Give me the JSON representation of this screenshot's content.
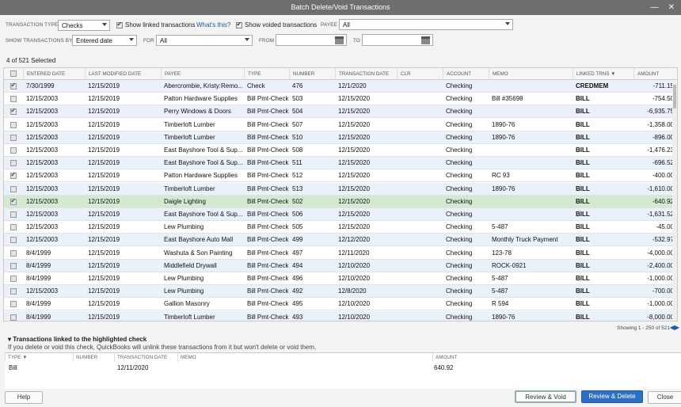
{
  "window": {
    "title": "Batch Delete/Void Transactions",
    "minimize": "—",
    "close": "✕"
  },
  "filters": {
    "transaction_type_label": "TRANSACTION TYPE",
    "transaction_type_value": "Checks",
    "show_linked_label": "Show linked transactions",
    "show_linked_checked": true,
    "whats_this": "What's this?",
    "show_voided_label": "Show voided transactions",
    "show_voided_checked": true,
    "payee_label": "PAYEE",
    "payee_value": "All",
    "show_by_label": "SHOW TRANSACTIONS BY",
    "show_by_value": "Entered date",
    "for_label": "FOR",
    "for_value": "All",
    "from_label": "FROM",
    "from_value": "",
    "to_label": "TO",
    "to_value": ""
  },
  "selected_count": "4 of 521 Selected",
  "grid": {
    "headers": {
      "entered": "ENTERED DATE",
      "modified": "LAST MODIFIED DATE",
      "payee": "PAYEE",
      "type": "TYPE",
      "number": "NUMBER",
      "txn_date": "TRANSACTION DATE",
      "clr": "CLR",
      "account": "ACCOUNT",
      "memo": "MEMO",
      "linked": "LINKED TRNS ▼",
      "amount": "AMOUNT"
    },
    "rows": [
      {
        "checked": true,
        "entered": "7/30/1999",
        "modified": "12/15/2019",
        "payee": "Abercrombie, Kristy:Remo...",
        "type": "Check",
        "number": "476",
        "txn_date": "12/1/2020",
        "clr": "",
        "account": "Checking",
        "memo": "",
        "linked": "CREDMEM",
        "amount": "-711.15"
      },
      {
        "checked": false,
        "entered": "12/15/2003",
        "modified": "12/15/2019",
        "payee": "Patton Hardware Supplies",
        "type": "Bill Pmt-Check",
        "number": "503",
        "txn_date": "12/15/2020",
        "clr": "",
        "account": "Checking",
        "memo": "Bill #35698",
        "linked": "BILL",
        "amount": "-754.50"
      },
      {
        "checked": true,
        "entered": "12/15/2003",
        "modified": "12/15/2019",
        "payee": "Perry Windows & Doors",
        "type": "Bill Pmt-Check",
        "number": "504",
        "txn_date": "12/15/2020",
        "clr": "",
        "account": "Checking",
        "memo": "",
        "linked": "BILL",
        "amount": "-6,935.75"
      },
      {
        "checked": false,
        "entered": "12/15/2003",
        "modified": "12/15/2019",
        "payee": "Timberloft Lumber",
        "type": "Bill Pmt-Check",
        "number": "507",
        "txn_date": "12/15/2020",
        "clr": "",
        "account": "Checking",
        "memo": "1890-76",
        "linked": "BILL",
        "amount": "-1,358.00"
      },
      {
        "checked": false,
        "entered": "12/15/2003",
        "modified": "12/15/2019",
        "payee": "Timberloft Lumber",
        "type": "Bill Pmt-Check",
        "number": "510",
        "txn_date": "12/15/2020",
        "clr": "",
        "account": "Checking",
        "memo": "1890-76",
        "linked": "BILL",
        "amount": "-896.00"
      },
      {
        "checked": false,
        "entered": "12/15/2003",
        "modified": "12/15/2019",
        "payee": "East Bayshore Tool & Sup...",
        "type": "Bill Pmt-Check",
        "number": "508",
        "txn_date": "12/15/2020",
        "clr": "",
        "account": "Checking",
        "memo": "",
        "linked": "BILL",
        "amount": "-1,476.23"
      },
      {
        "checked": false,
        "entered": "12/15/2003",
        "modified": "12/15/2019",
        "payee": "East Bayshore Tool & Sup...",
        "type": "Bill Pmt-Check",
        "number": "511",
        "txn_date": "12/15/2020",
        "clr": "",
        "account": "Checking",
        "memo": "",
        "linked": "BILL",
        "amount": "-696.52"
      },
      {
        "checked": true,
        "entered": "12/15/2003",
        "modified": "12/15/2019",
        "payee": "Patton Hardware Supplies",
        "type": "Bill Pmt-Check",
        "number": "512",
        "txn_date": "12/15/2020",
        "clr": "",
        "account": "Checking",
        "memo": "RC 93",
        "linked": "BILL",
        "amount": "-400.00"
      },
      {
        "checked": false,
        "entered": "12/15/2003",
        "modified": "12/15/2019",
        "payee": "Timberloft Lumber",
        "type": "Bill Pmt-Check",
        "number": "513",
        "txn_date": "12/15/2020",
        "clr": "",
        "account": "Checking",
        "memo": "1890-76",
        "linked": "BILL",
        "amount": "-1,610.00"
      },
      {
        "checked": true,
        "entered": "12/15/2003",
        "modified": "12/15/2019",
        "payee": "Daigle Lighting",
        "type": "Bill Pmt-Check",
        "number": "502",
        "txn_date": "12/15/2020",
        "clr": "",
        "account": "Checking",
        "memo": "",
        "linked": "BILL",
        "amount": "-640.92",
        "highlight": true
      },
      {
        "checked": false,
        "entered": "12/15/2003",
        "modified": "12/15/2019",
        "payee": "East Bayshore Tool & Sup...",
        "type": "Bill Pmt-Check",
        "number": "506",
        "txn_date": "12/15/2020",
        "clr": "",
        "account": "Checking",
        "memo": "",
        "linked": "BILL",
        "amount": "-1,631.52"
      },
      {
        "checked": false,
        "entered": "12/15/2003",
        "modified": "12/15/2019",
        "payee": "Lew Plumbing",
        "type": "Bill Pmt-Check",
        "number": "505",
        "txn_date": "12/15/2020",
        "clr": "",
        "account": "Checking",
        "memo": "5-487",
        "linked": "BILL",
        "amount": "-45.00"
      },
      {
        "checked": false,
        "entered": "12/15/2003",
        "modified": "12/15/2019",
        "payee": "East Bayshore Auto Mall",
        "type": "Bill Pmt-Check",
        "number": "499",
        "txn_date": "12/12/2020",
        "clr": "",
        "account": "Checking",
        "memo": "Monthly Truck Payment",
        "linked": "BILL",
        "amount": "-532.97"
      },
      {
        "checked": false,
        "entered": "8/4/1999",
        "modified": "12/15/2019",
        "payee": "Washuta & Son Painting",
        "type": "Bill Pmt-Check",
        "number": "497",
        "txn_date": "12/11/2020",
        "clr": "",
        "account": "Checking",
        "memo": "123-78",
        "linked": "BILL",
        "amount": "-4,000.00"
      },
      {
        "checked": false,
        "entered": "8/4/1999",
        "modified": "12/15/2019",
        "payee": "Middlefield Drywall",
        "type": "Bill Pmt-Check",
        "number": "494",
        "txn_date": "12/10/2020",
        "clr": "",
        "account": "Checking",
        "memo": "ROCK-0921",
        "linked": "BILL",
        "amount": "-2,400.00"
      },
      {
        "checked": false,
        "entered": "8/4/1999",
        "modified": "12/15/2019",
        "payee": "Lew Plumbing",
        "type": "Bill Pmt-Check",
        "number": "496",
        "txn_date": "12/10/2020",
        "clr": "",
        "account": "Checking",
        "memo": "5-487",
        "linked": "BILL",
        "amount": "-1,000.00"
      },
      {
        "checked": false,
        "entered": "12/15/2003",
        "modified": "12/15/2019",
        "payee": "Lew Plumbing",
        "type": "Bill Pmt-Check",
        "number": "492",
        "txn_date": "12/8/2020",
        "clr": "",
        "account": "Checking",
        "memo": "5-487",
        "linked": "BILL",
        "amount": "-700.00"
      },
      {
        "checked": false,
        "entered": "8/4/1999",
        "modified": "12/15/2019",
        "payee": "Gallion Masonry",
        "type": "Bill Pmt-Check",
        "number": "495",
        "txn_date": "12/10/2020",
        "clr": "",
        "account": "Checking",
        "memo": "R 594",
        "linked": "BILL",
        "amount": "-1,000.00"
      },
      {
        "checked": false,
        "entered": "8/4/1999",
        "modified": "12/15/2019",
        "payee": "Timberloft Lumber",
        "type": "Bill Pmt-Check",
        "number": "493",
        "txn_date": "12/10/2020",
        "clr": "",
        "account": "Checking",
        "memo": "1890-76",
        "linked": "BILL",
        "amount": "-8,000.00"
      }
    ]
  },
  "pager": {
    "showing": "Showing 1 - 250 of 521"
  },
  "linked": {
    "title": "Transactions linked to the highlighted check",
    "note": "If you delete or void this check, QuickBooks will unlink these transactions from it but won't delete or void them.",
    "headers": {
      "type": "TYPE ▼",
      "number": "NUMBER",
      "txn_date": "TRANSACTION DATE",
      "memo": "MEMO",
      "amount": "AMOUNT"
    },
    "row": {
      "type": "Bill",
      "number": "",
      "txn_date": "12/11/2020",
      "memo": "",
      "amount": "640.92"
    }
  },
  "buttons": {
    "help": "Help",
    "review_void": "Review & Void",
    "review_delete": "Review & Delete",
    "close": "Close"
  }
}
